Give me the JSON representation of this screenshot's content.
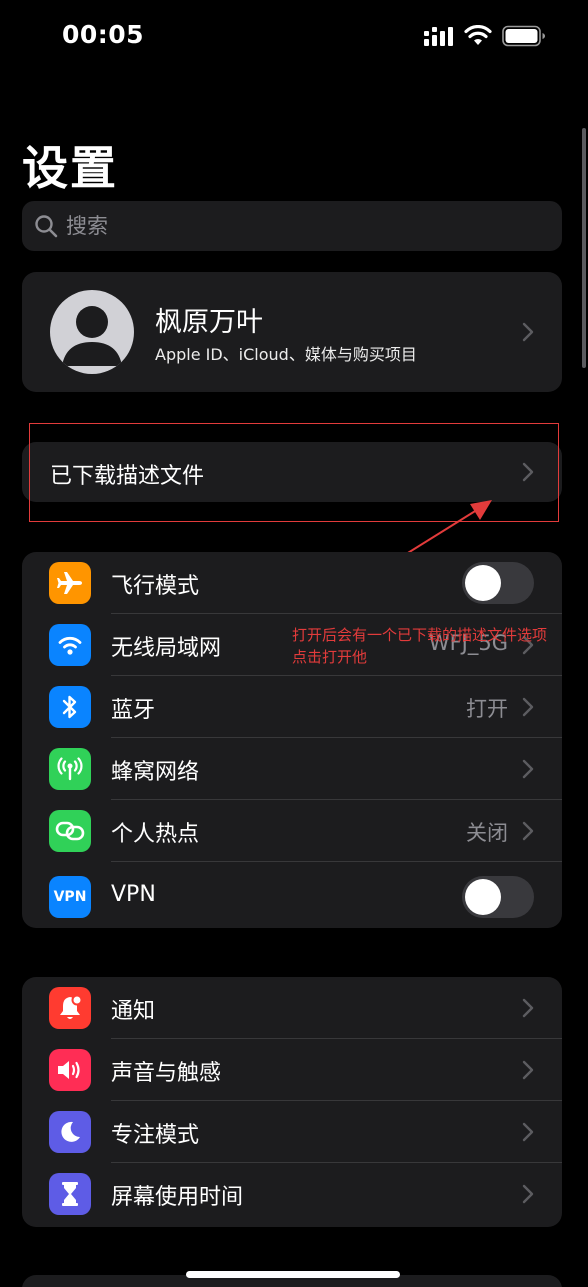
{
  "status": {
    "time": "00:05",
    "icons": [
      "cellular-signal-icon",
      "wifi-icon",
      "battery-icon"
    ]
  },
  "page": {
    "title": "设置"
  },
  "search": {
    "placeholder": "搜索"
  },
  "profile": {
    "name": "枫原万叶",
    "subtitle": "Apple ID、iCloud、媒体与购买项目"
  },
  "downloaded_profile": {
    "label": "已下载描述文件"
  },
  "annotation": {
    "line1": "打开后会有一个已下载的描述文件选项",
    "line2": "点击打开他",
    "color": "#e23b3b"
  },
  "network": {
    "airplane": {
      "label": "飞行模式",
      "on": false,
      "icon": "airplane-icon",
      "color": "#ff9500"
    },
    "wifi": {
      "label": "无线局域网",
      "value": "WFJ_5G",
      "icon": "wifi-icon",
      "color": "#0a84ff"
    },
    "bluetooth": {
      "label": "蓝牙",
      "value": "打开",
      "icon": "bluetooth-icon",
      "color": "#0a84ff"
    },
    "cellular": {
      "label": "蜂窝网络",
      "icon": "cellular-antenna-icon",
      "color": "#30d158"
    },
    "hotspot": {
      "label": "个人热点",
      "value": "关闭",
      "icon": "hotspot-icon",
      "color": "#30d158"
    },
    "vpn": {
      "label": "VPN",
      "icon_text": "VPN",
      "on": false,
      "color": "#0a84ff"
    }
  },
  "notif_group": {
    "notifications": {
      "label": "通知",
      "icon": "bell-icon",
      "color": "#ff3b30"
    },
    "sounds": {
      "label": "声音与触感",
      "icon": "speaker-icon",
      "color": "#ff2d55"
    },
    "focus": {
      "label": "专注模式",
      "icon": "moon-icon",
      "color": "#5e5ce6"
    },
    "screentime": {
      "label": "屏幕使用时间",
      "icon": "hourglass-icon",
      "color": "#5e5ce6"
    }
  }
}
